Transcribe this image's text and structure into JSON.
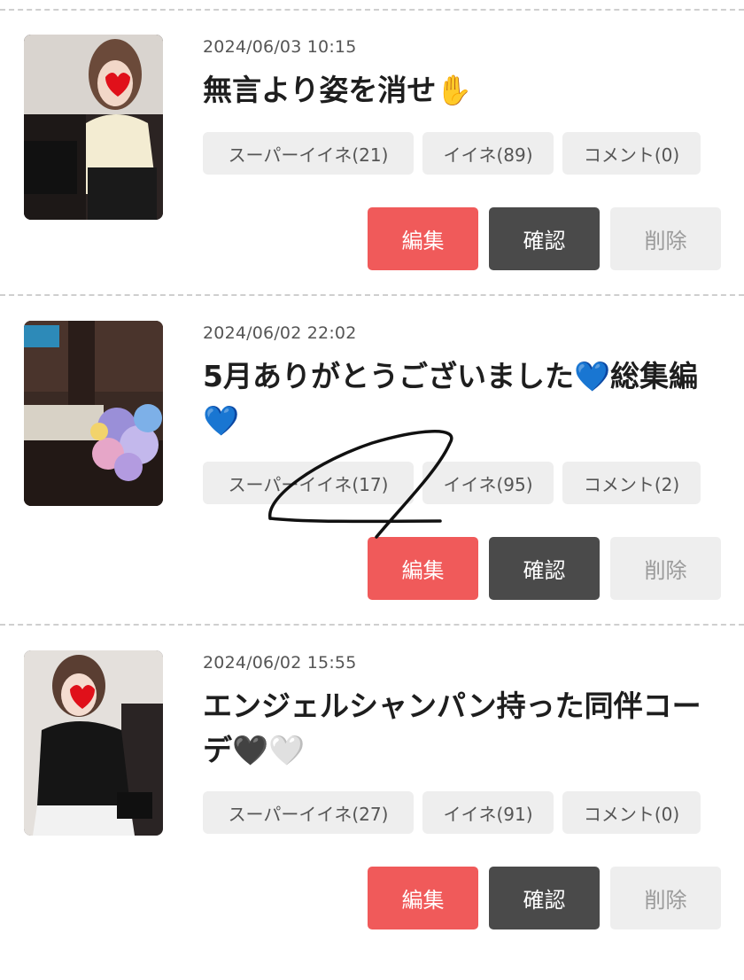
{
  "posts": [
    {
      "date": "2024/06/03 10:15",
      "title": "無言より姿を消せ",
      "title_emoji": "✋",
      "tags": {
        "super_like": "スーパーイイネ(21)",
        "like": "イイネ(89)",
        "comment": "コメント(0)"
      },
      "buttons": {
        "edit": "編集",
        "confirm": "確認",
        "delete": "削除"
      }
    },
    {
      "date": "2024/06/02 22:02",
      "title": "5月ありがとうございました💙総集編",
      "title_emoji": "💙",
      "tags": {
        "super_like": "スーパーイイネ(17)",
        "like": "イイネ(95)",
        "comment": "コメント(2)"
      },
      "buttons": {
        "edit": "編集",
        "confirm": "確認",
        "delete": "削除"
      }
    },
    {
      "date": "2024/06/02 15:55",
      "title": "エンジェルシャンパン持った同伴コーデ",
      "title_emoji": "🖤🤍",
      "tags": {
        "super_like": "スーパーイイネ(27)",
        "like": "イイネ(91)",
        "comment": "コメント(0)"
      },
      "buttons": {
        "edit": "編集",
        "confirm": "確認",
        "delete": "削除"
      }
    }
  ],
  "colors": {
    "edit": "#f05a5a",
    "confirm": "#4a4a4a",
    "delete_bg": "#eeeeee",
    "tag_bg": "#eeeeee"
  }
}
